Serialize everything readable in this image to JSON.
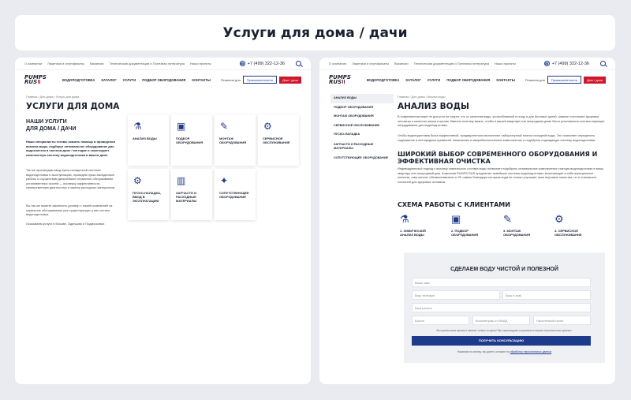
{
  "page_title": "Услуги для дома / дачи",
  "topbar": {
    "links": [
      "О компании",
      "Лицензии и сертификаты",
      "Вакансии",
      "Техническая документация и Полезная литература",
      "Наши проекты"
    ],
    "phone": "+7 (499) 322-12-36"
  },
  "nav": {
    "logo_line1": "PUMPS",
    "logo_line2": "RUS",
    "menu": [
      "Водоподготовка",
      "Каталог",
      "Услуги",
      "Подбор оборудования",
      "Контакты"
    ],
    "solutions_label": "Решения для",
    "solutions_value": "Промышленности",
    "cta_label": "Дом / дача"
  },
  "left": {
    "breadcrumb": "Главная / Для дома / Услуги для дома",
    "heading": "Услуги для дома",
    "subheading_line1": "Наши услуги",
    "subheading_line2": "для дома / дачи",
    "intro_bold": "Наши специалисты готовы оказать помощь в проведении анализа воды, подберут оптимальное оборудование для водоочистки в частном доме / коттедже и смонтируют комплектную систему водоподготовки в вашем доме.",
    "para2": "Так же производим ввод пуско-наладочной системы водоподготовки в эксплуатацию, проведем пуско-наладочные работы и осуществим дальнейшее сервисное обслуживание установленных систем — проверку эффективности, своевременную диагностику и замену расходных материалов.",
    "para3": "Вы так же можете заключить договор с нашей компанией на сервисное обслуживание уже существующих у вас систем водоподготовки.",
    "para4": "Оказываем услуги в Москве, Одинцово и Подмосковье.",
    "cards": [
      {
        "label": "Анализ воды",
        "icon": "flask-icon",
        "glyph": "⚗"
      },
      {
        "label": "Подбор оборудования",
        "icon": "chat-icon",
        "glyph": "▣"
      },
      {
        "label": "Монтаж оборудования",
        "icon": "wrench-icon",
        "glyph": "✎"
      },
      {
        "label": "Сервисное обслуживание",
        "icon": "gear-icon",
        "glyph": "⚙"
      },
      {
        "label": "Пуско-наладка, ввод в эксплуатацию",
        "icon": "gears-icon",
        "glyph": "⚙"
      },
      {
        "label": "Запчасти и расходные материалы",
        "icon": "filter-icon",
        "glyph": "▥"
      },
      {
        "label": "Сопутствующее оборудование",
        "icon": "star-icon",
        "glyph": "✦"
      }
    ]
  },
  "right": {
    "breadcrumb": "Главная / Для дома / Анализ воды",
    "sidebar": [
      "Анализ воды",
      "Подбор оборудования",
      "Монтаж оборудования",
      "Сервисное обслуживание",
      "Пуско-наладка",
      "Запчасти и расходные материалы",
      "Сопутствующее оборудование"
    ],
    "heading": "Анализ воды",
    "para1": "В современном мире не для кого не секрет, что от качества воды, употребляемой в пищу и для бытовых целей, зависит состояние здоровья человека и качество жизни в целом. Именно поэтому важно, чтобы в вашей квартире или загородном доме была установлена соответствующее оборудование для водоподготовки.",
    "para2": "Чтобы водоподготовка была эффективной, предварительно выполняют лабораторный анализ исходной воды. Это позволяет определить содержание в ней вредных примесей, химических и микробиологических компонентов, и подобрать подходящую систему водоподготовки.",
    "h2": "Широкий выбор современного оборудования и эффективная очистка",
    "para3": "Индивидуальный подход к анализу химического состава воды позволяет подобрать оптимальные комплектные станции водоподготовки в вашу квартиру или загородный дом. Компания PUMPS RUS предлагает новейшие системы водоподготовки, включающие в себя аэрационные колонны, смягчители, обезжелезватели и УФ лампы благодаря которым вода не только улучшает свои вкусовые качества, но и становится полезной для здоровья человека.",
    "scheme_title": "Схема работы с клиентами",
    "steps": [
      {
        "label": "1. Химический анализ воды",
        "icon": "flask-icon",
        "glyph": "⚗"
      },
      {
        "label": "2. Подбор оборудования",
        "icon": "chat-icon",
        "glyph": "▣"
      },
      {
        "label": "3. Монтаж оборудования",
        "icon": "wrench-icon",
        "glyph": "✎"
      },
      {
        "label": "4. Сервисное обслуживание",
        "icon": "gear-icon",
        "glyph": "⚙"
      }
    ],
    "form": {
      "title": "Сделаем воду чистой и полезной",
      "name_ph": "Ваше имя",
      "phone_ph": "Ваш телефон",
      "email_ph": "Ваш e-mail",
      "region_ph": "Ваш регион",
      "highway_ph": "Шоссе",
      "distance_ph": "Километраж от МКАД",
      "settlement_ph": "Населенный пункт",
      "consent_note": "Мы ценим ваше время и звоним только по делу! Мы гарантируем сохранность ваших персональных данных.",
      "submit_label": "Получить консультацию",
      "policy_note": "Нажимая на кнопку, вы даете согласие на",
      "policy_link": "обработку персональных данных"
    }
  }
}
